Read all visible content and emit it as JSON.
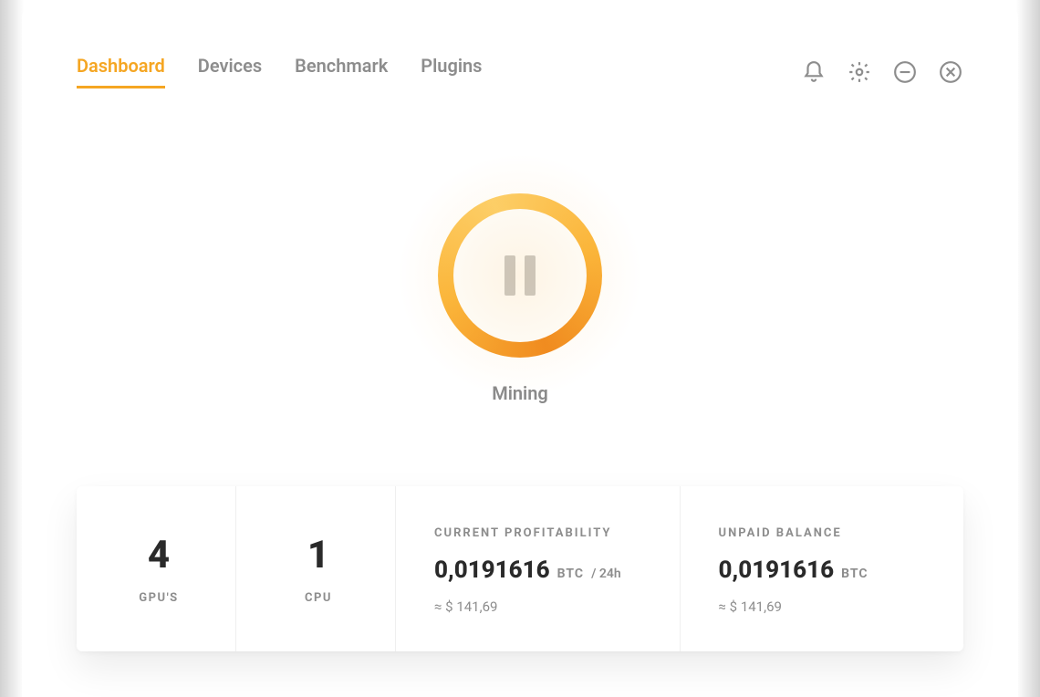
{
  "colors": {
    "accent": "#f5a623",
    "text_muted": "#8d8d8d",
    "text": "#2a2a2a"
  },
  "nav": {
    "tabs": [
      {
        "label": "Dashboard",
        "active": true
      },
      {
        "label": "Devices",
        "active": false
      },
      {
        "label": "Benchmark",
        "active": false
      },
      {
        "label": "Plugins",
        "active": false
      }
    ],
    "icons": {
      "notifications": "bell-icon",
      "settings": "gear-icon",
      "minimize": "minimize-icon",
      "close": "close-icon"
    }
  },
  "mining": {
    "status_label": "Mining",
    "button_state": "pause"
  },
  "stats": {
    "gpu": {
      "count": "4",
      "label": "GPU'S"
    },
    "cpu": {
      "count": "1",
      "label": "CPU"
    },
    "profitability": {
      "title": "CURRENT PROFITABILITY",
      "value": "0,0191616",
      "unit": "BTC",
      "per": "/ 24h",
      "approx": "≈ $ 141,69"
    },
    "balance": {
      "title": "UNPAID BALANCE",
      "value": "0,0191616",
      "unit": "BTC",
      "approx": "≈ $ 141,69"
    }
  }
}
